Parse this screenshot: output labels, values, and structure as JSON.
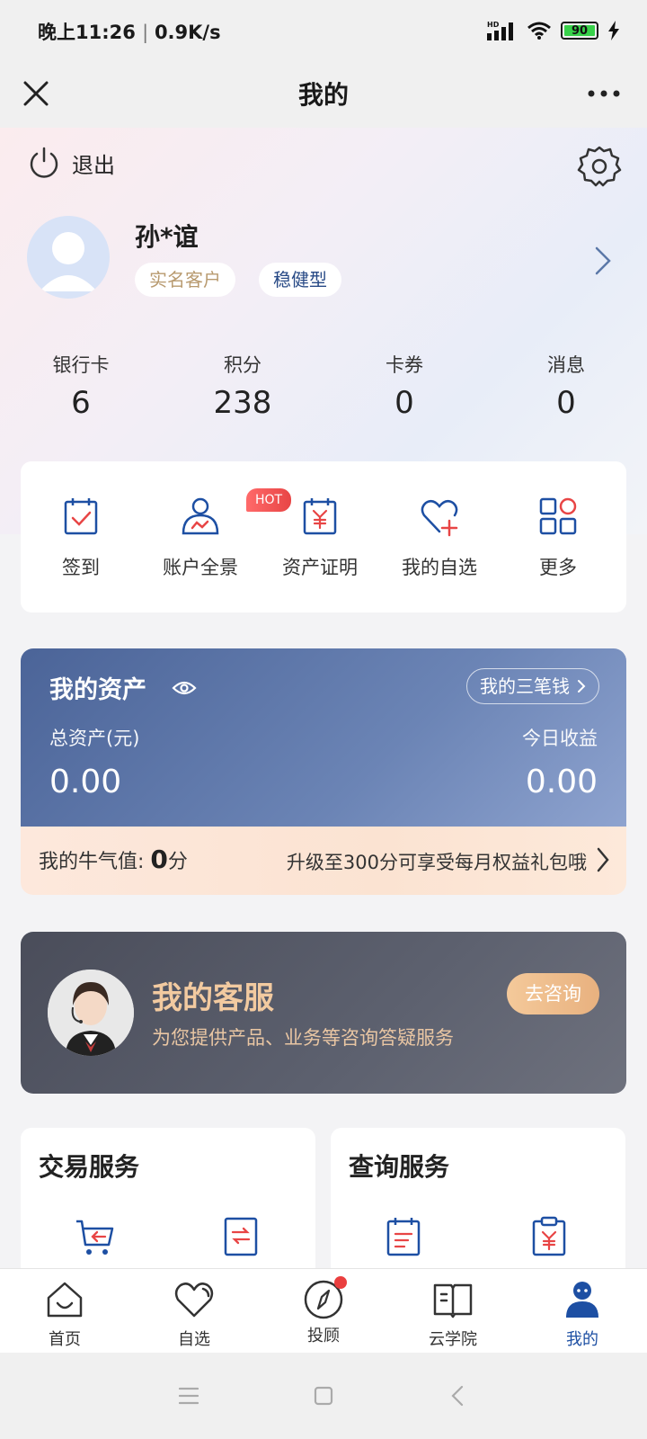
{
  "status_bar": {
    "time": "晚上11:26",
    "speed": "0.9K/s",
    "battery": "90"
  },
  "header": {
    "title": "我的"
  },
  "profile": {
    "logout_label": "退出",
    "name": "孙*谊",
    "tags": [
      "实名客户",
      "稳健型"
    ]
  },
  "stats": [
    {
      "label": "银行卡",
      "value": "6"
    },
    {
      "label": "积分",
      "value": "238"
    },
    {
      "label": "卡券",
      "value": "0"
    },
    {
      "label": "消息",
      "value": "0"
    }
  ],
  "quick_actions": {
    "items": [
      {
        "label": "签到",
        "icon": "calendar-check-icon"
      },
      {
        "label": "账户全景",
        "icon": "user-chart-icon"
      },
      {
        "label": "资产证明",
        "icon": "yuan-certificate-icon"
      },
      {
        "label": "我的自选",
        "icon": "heart-plus-icon"
      },
      {
        "label": "更多",
        "icon": "grid-icon"
      }
    ],
    "hot_badge": "HOT"
  },
  "assets": {
    "title": "我的资产",
    "three_money": "我的三笔钱",
    "total_label": "总资产(元)",
    "total_value": "0.00",
    "today_label": "今日收益",
    "today_value": "0.00"
  },
  "bull": {
    "label": "我的牛气值:",
    "score": "0",
    "unit": "分",
    "upgrade_text": "升级至300分可享受每月权益礼包哦"
  },
  "customer_service": {
    "title": "我的客服",
    "subtitle": "为您提供产品、业务等咨询答疑服务",
    "button": "去咨询"
  },
  "services": {
    "trade_title": "交易服务",
    "query_title": "查询服务"
  },
  "bottom_nav": [
    {
      "label": "首页",
      "icon": "home-icon"
    },
    {
      "label": "自选",
      "icon": "heart-icon"
    },
    {
      "label": "投顾",
      "icon": "compass-icon"
    },
    {
      "label": "云学院",
      "icon": "book-icon"
    },
    {
      "label": "我的",
      "icon": "person-icon"
    }
  ],
  "colors": {
    "primary": "#1d4fa3",
    "accent_red": "#e84545",
    "gold": "#e8b17f"
  }
}
